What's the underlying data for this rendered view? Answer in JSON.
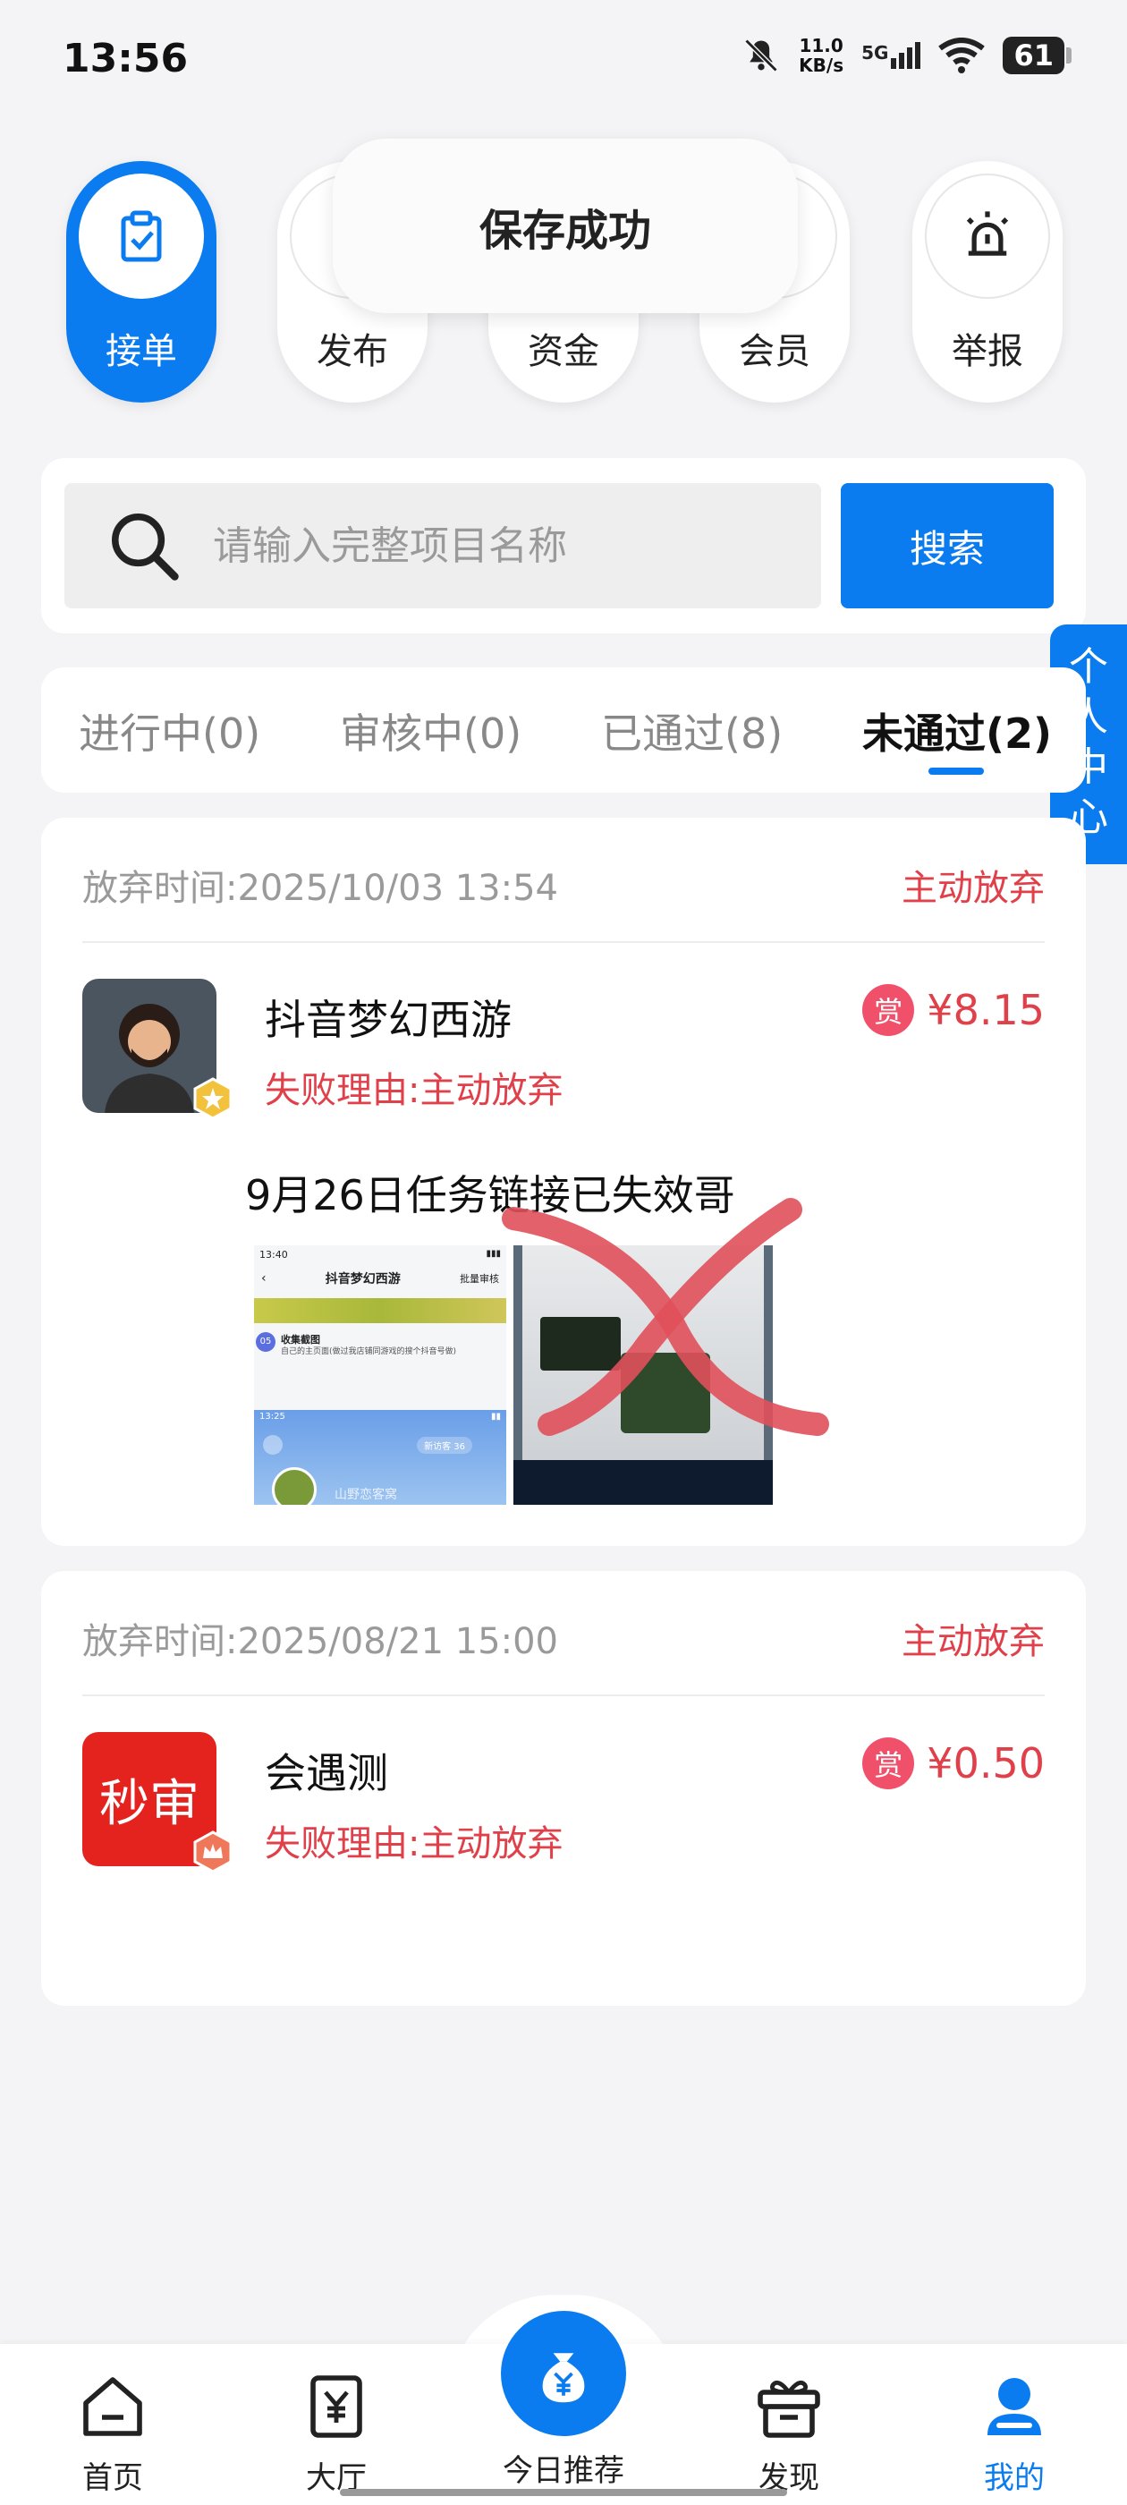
{
  "status_bar": {
    "time": "13:56",
    "net_speed_value": "11.0",
    "net_speed_unit": "KB/s",
    "network": "5G",
    "battery": "61"
  },
  "top_nav": {
    "items": [
      {
        "label": "接单",
        "icon": "clipboard-check-icon",
        "active": true
      },
      {
        "label": "发布",
        "icon": "publish-icon",
        "active": false
      },
      {
        "label": "资金",
        "icon": "wallet-icon",
        "active": false
      },
      {
        "label": "会员",
        "icon": "member-icon",
        "active": false
      },
      {
        "label": "举报",
        "icon": "alarm-light-icon",
        "active": false
      }
    ]
  },
  "toast": {
    "text": "保存成功"
  },
  "search": {
    "placeholder": "请输入完整项目名称",
    "button_label": "搜索"
  },
  "side_tab": {
    "chars": [
      "个",
      "人",
      "中",
      "心"
    ]
  },
  "tabs": [
    {
      "label": "进行中(0)",
      "active": false
    },
    {
      "label": "审核中(0)",
      "active": false
    },
    {
      "label": "已通过(8)",
      "active": false
    },
    {
      "label": "未通过(2)",
      "active": true
    }
  ],
  "records": [
    {
      "time": "放弃时间:2025/10/03 13:54",
      "status": "主动放弃",
      "title": "抖音梦幻西游",
      "reason": "失败理由:主动放弃",
      "reward_chip": "赏",
      "amount": "¥8.15",
      "note": "9月26日任务链接已失效哥",
      "thumb_a": {
        "time": "13:40",
        "title": "抖音梦幻西游",
        "action": "批量审核",
        "step_no": "05",
        "step_title": "收集截图",
        "step_desc": "自己的主页面(做过我店铺同游戏的搜个抖音号做)",
        "inner_time": "13:25",
        "visitors": "新访客 36",
        "user": "山野恋客窝"
      }
    },
    {
      "time": "放弃时间:2025/08/21 15:00",
      "status": "主动放弃",
      "title": "会遇测",
      "reason": "失败理由:主动放弃",
      "reward_chip": "赏",
      "amount": "¥0.50",
      "avatar_text": "秒审"
    }
  ],
  "bottom_nav": {
    "items": [
      {
        "label": "首页",
        "icon": "home-icon"
      },
      {
        "label": "大厅",
        "icon": "hall-yuan-icon"
      },
      {
        "label": "今日推荐",
        "icon": "money-bag-icon"
      },
      {
        "label": "发现",
        "icon": "gift-box-icon"
      },
      {
        "label": "我的",
        "icon": "profile-icon"
      }
    ]
  },
  "colors": {
    "accent": "#0a7cf0",
    "danger": "#e0404a",
    "background": "#f4f4f6"
  }
}
